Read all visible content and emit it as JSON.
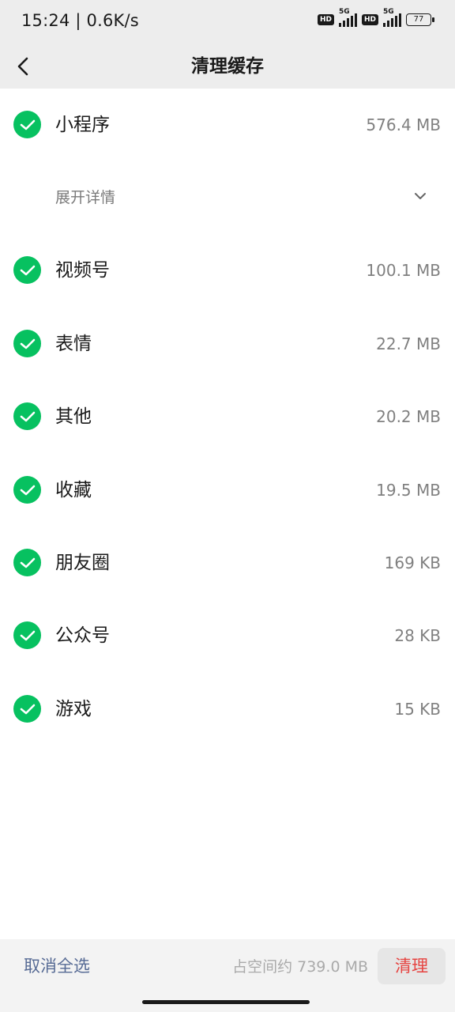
{
  "status_bar": {
    "time": "15:24 | 0.6K/s",
    "sim1_badge": "HD",
    "sim1_network": "5G",
    "sim2_badge": "HD",
    "sim2_network": "5G",
    "battery": "77"
  },
  "nav": {
    "title": "清理缓存",
    "back_icon": "chevron-left-icon"
  },
  "items": [
    {
      "label": "小程序",
      "size": "576.4 MB",
      "checked": true
    },
    {
      "label": "视频号",
      "size": "100.1 MB",
      "checked": true
    },
    {
      "label": "表情",
      "size": "22.7 MB",
      "checked": true
    },
    {
      "label": "其他",
      "size": "20.2 MB",
      "checked": true
    },
    {
      "label": "收藏",
      "size": "19.5 MB",
      "checked": true
    },
    {
      "label": "朋友圈",
      "size": "169 KB",
      "checked": true
    },
    {
      "label": "公众号",
      "size": "28 KB",
      "checked": true
    },
    {
      "label": "游戏",
      "size": "15 KB",
      "checked": true
    }
  ],
  "expand": {
    "label": "展开详情",
    "icon": "chevron-down-icon"
  },
  "bottom_bar": {
    "deselect_label": "取消全选",
    "occupied_text": "占空间约 739.0 MB",
    "clean_label": "清理"
  },
  "colors": {
    "accent_green": "#07c160",
    "link_blue": "#576b95",
    "danger_red": "#e64340"
  }
}
